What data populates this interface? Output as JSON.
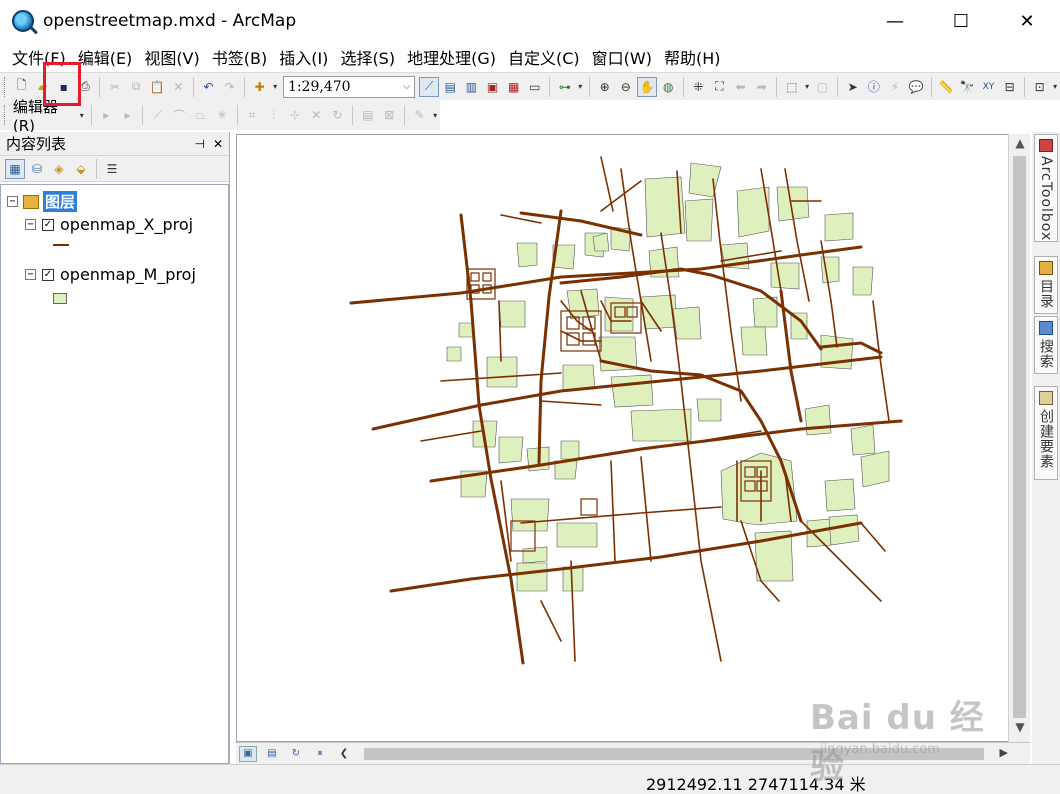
{
  "window": {
    "title": "openstreetmap.mxd - ArcMap",
    "minimize": "—",
    "maximize": "☐",
    "close": "✕"
  },
  "menu": [
    "文件(F)",
    "编辑(E)",
    "视图(V)",
    "书签(B)",
    "插入(I)",
    "选择(S)",
    "地理处理(G)",
    "自定义(C)",
    "窗口(W)",
    "帮助(H)"
  ],
  "toolbar": {
    "scale_value": "1:29,470",
    "editor_label": "编辑器(R)"
  },
  "toc": {
    "title": "内容列表",
    "pin": "⊣",
    "close": "✕",
    "root_label": "图层",
    "layers": [
      {
        "name": "openmap_X_proj",
        "checked": true,
        "symbol": "line"
      },
      {
        "name": "openmap_M_proj",
        "checked": true,
        "symbol": "polygon"
      }
    ]
  },
  "dock": {
    "tabs": [
      "ArcToolbox",
      "目录",
      "搜索",
      "创建要素"
    ]
  },
  "status": {
    "coordinates": "2912492.11  2747114.34 米"
  },
  "watermark": {
    "main": "Bai du 经验",
    "sub": "jingyan.baidu.com"
  },
  "colors": {
    "road": "#7a3000",
    "polygon_fill": "#dff0bf",
    "polygon_stroke": "#555555",
    "highlight": "#e8192c",
    "selection": "#2f7fd8"
  }
}
